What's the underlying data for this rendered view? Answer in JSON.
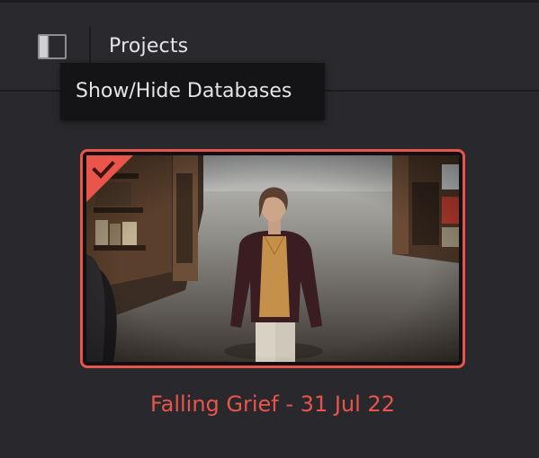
{
  "header": {
    "title": "Projects",
    "database_toggle_icon": "sidebar-panel-icon"
  },
  "tooltip": {
    "text": "Show/Hide Databases"
  },
  "projects": [
    {
      "name": "Falling Grief - 31 Jul 22",
      "selected": true,
      "selection_icon": "checkmark-icon",
      "thumbnail": "woman-in-library-frame"
    }
  ],
  "colors": {
    "background": "#29292d",
    "accent": "#e9554a",
    "text": "#e4e4e6",
    "tooltip_bg": "#141416"
  }
}
